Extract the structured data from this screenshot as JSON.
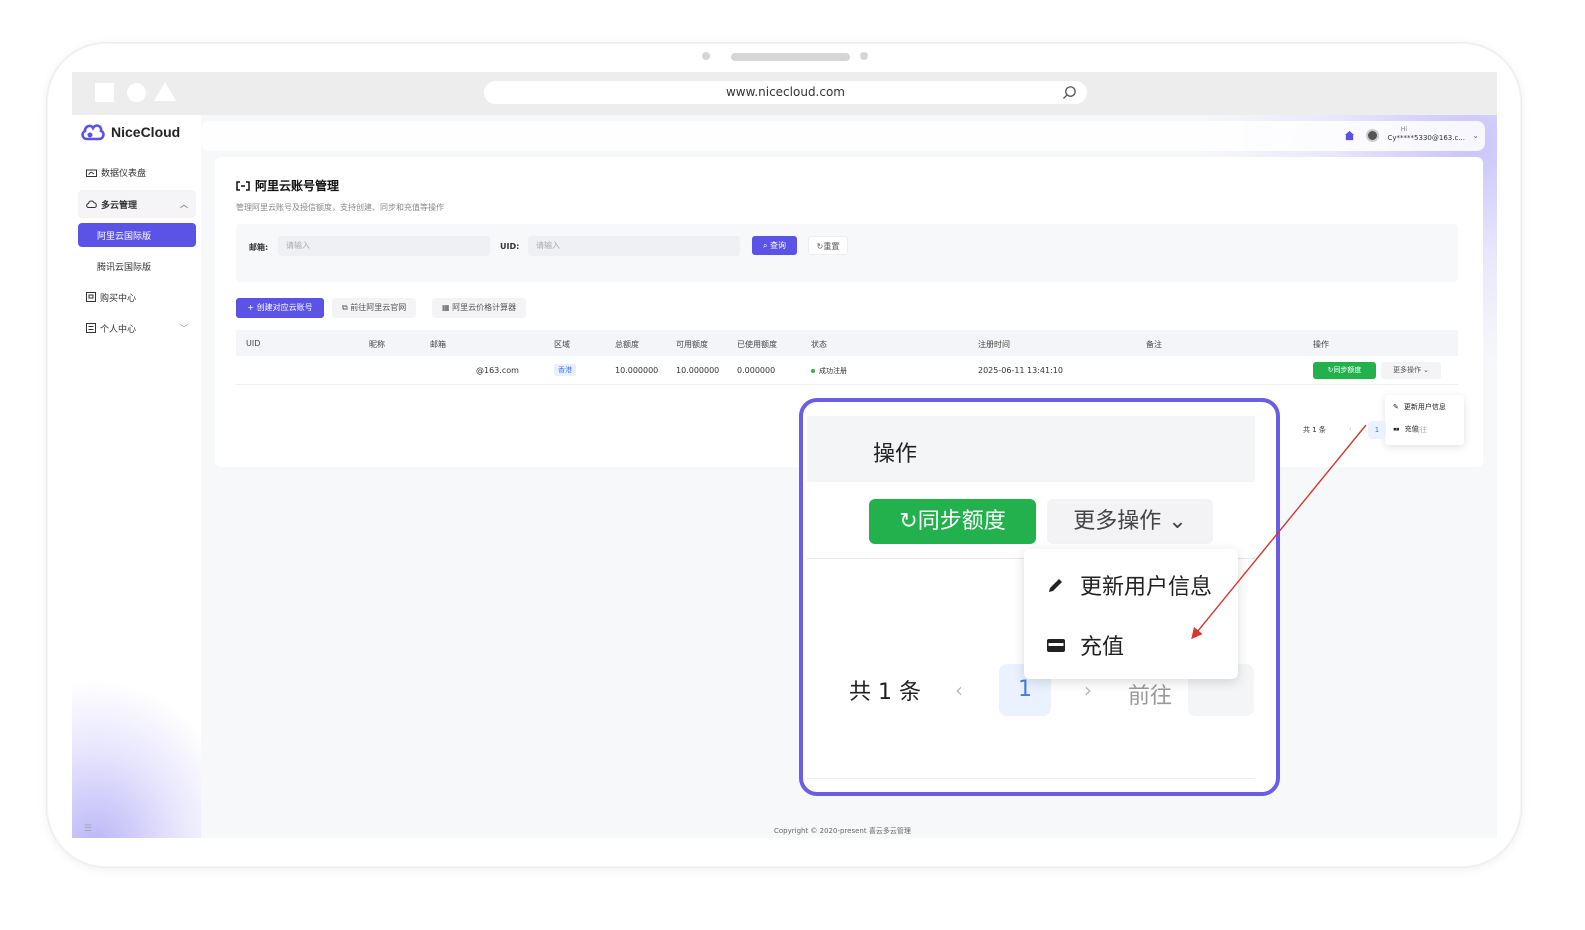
{
  "browser": {
    "url": "www.nicecloud.com"
  },
  "brand": {
    "name": "NiceCloud",
    "accent": "#5b53e6",
    "success": "#22b14c"
  },
  "sidebar": {
    "items": [
      {
        "label": "数据仪表盘",
        "icon": "dashboard-icon"
      },
      {
        "label": "多云管理",
        "icon": "cloud-icon",
        "expanded": true
      },
      {
        "label": "阿里云国际版",
        "active": true
      },
      {
        "label": "腾讯云国际版"
      },
      {
        "label": "购买中心",
        "icon": "cart-icon"
      },
      {
        "label": "个人中心",
        "icon": "user-icon"
      }
    ],
    "collapse_icon": "menu-fold-icon"
  },
  "topbar": {
    "greeting": "Hi",
    "user": "Cy*****5330@163.c..."
  },
  "page": {
    "title": "阿里云账号管理",
    "subtitle": "管理阿里云账号及授信额度，支持创建、同步和充值等操作"
  },
  "filter": {
    "email_label": "邮箱:",
    "email_placeholder": "请输入",
    "uid_label": "UID:",
    "uid_placeholder": "请输入",
    "query_label": "查询",
    "reset_label": "重置"
  },
  "actions": {
    "create_label": "+ 创建对应云账号",
    "official_label": "前往阿里云官网",
    "calculator_label": "阿里云价格计算器"
  },
  "table": {
    "columns": [
      "UID",
      "昵称",
      "邮箱",
      "区域",
      "总额度",
      "可用额度",
      "已使用额度",
      "状态",
      "注册时间",
      "备注",
      "操作"
    ],
    "rows": [
      {
        "uid": "",
        "nickname": "",
        "email": "@163.com",
        "region": "香港",
        "total": "10.000000",
        "available": "10.000000",
        "used": "0.000000",
        "status": "成功注册",
        "registered": "2025-06-11 13:41:10",
        "note": ""
      }
    ],
    "sync_label": "同步额度",
    "more_label": "更多操作",
    "dropdown": [
      "更新用户信息",
      "充值"
    ]
  },
  "pagination": {
    "total": "共 1 条",
    "page": "1",
    "goto": "前往"
  },
  "footer": {
    "copyright": "Copyright © 2020-present 喜云多云管理"
  },
  "zoom": {
    "header": "操作",
    "sync_label": "同步额度",
    "more_label": "更多操作",
    "dropdown": [
      "更新用户信息",
      "充值"
    ],
    "total": "共 1 条",
    "page": "1",
    "goto": "前往"
  }
}
